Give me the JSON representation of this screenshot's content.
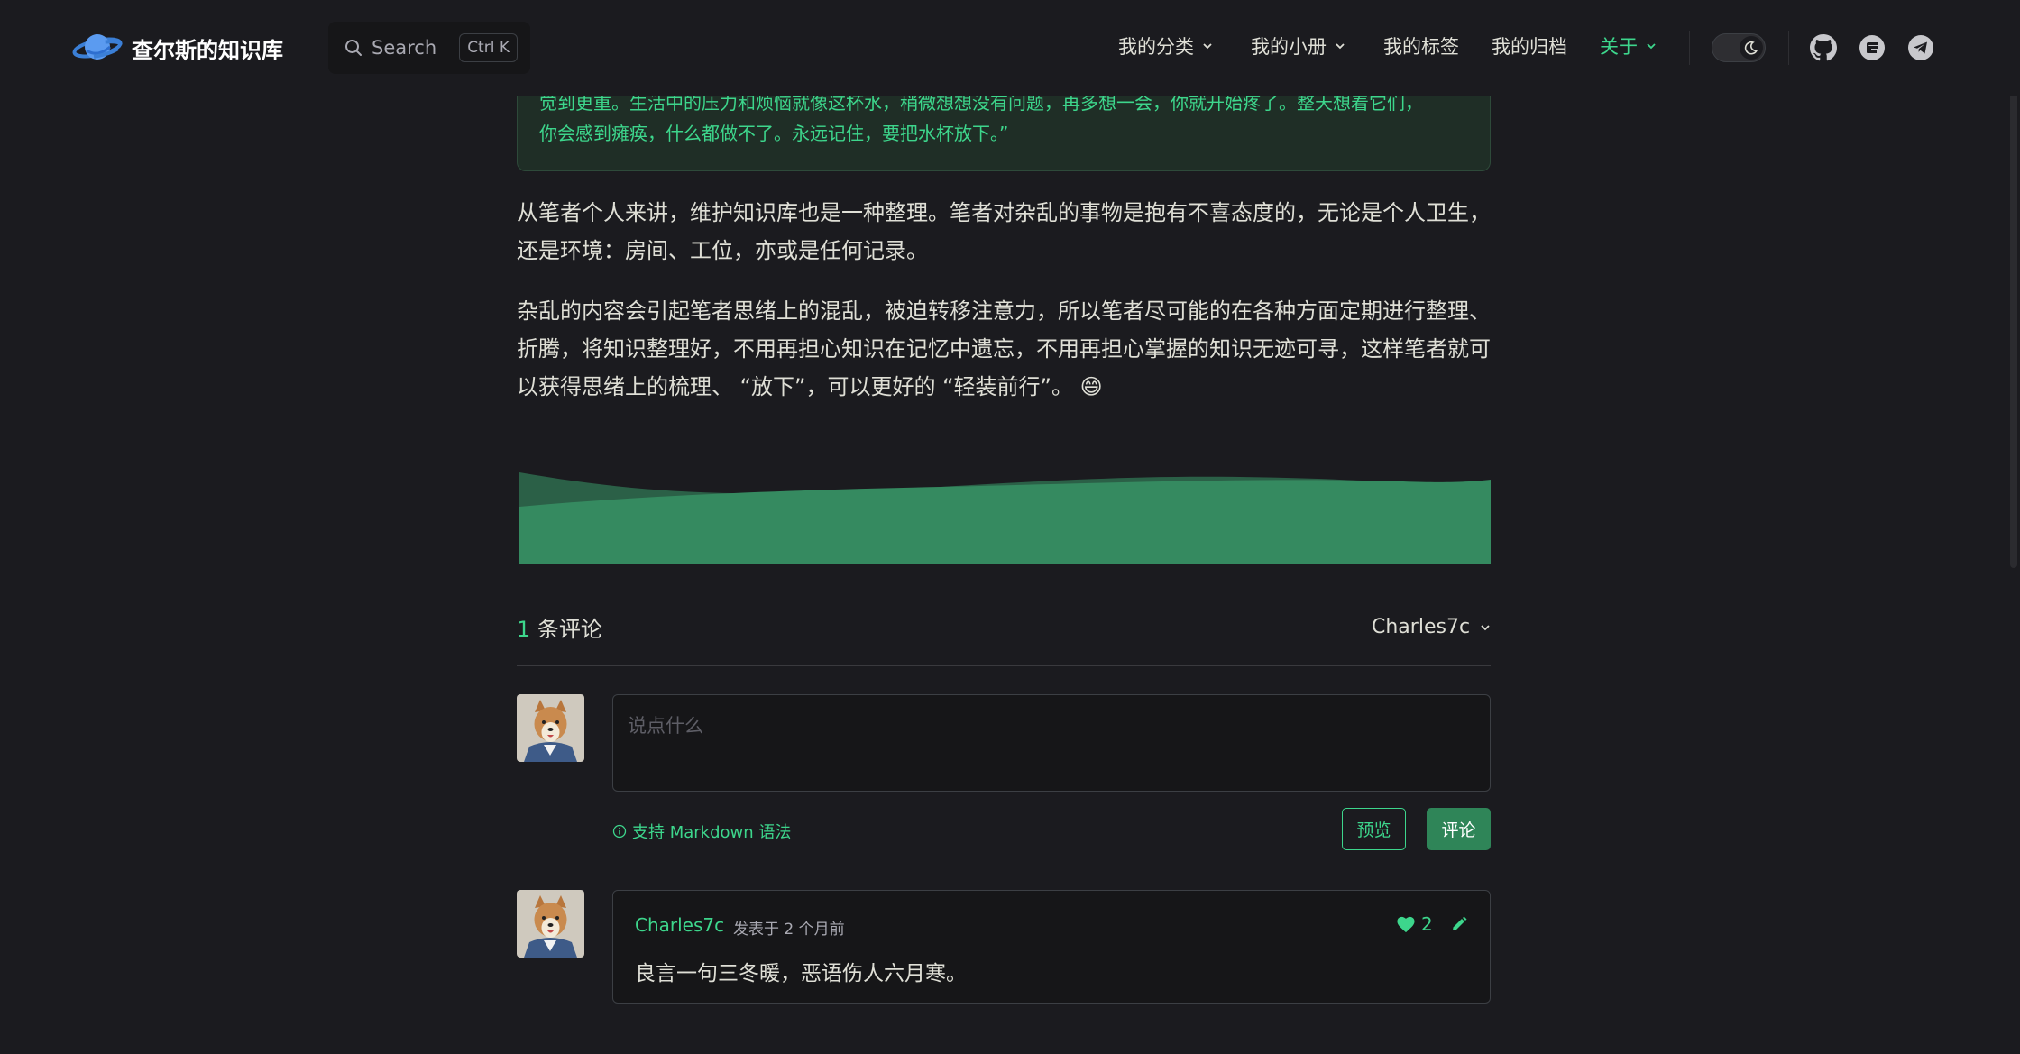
{
  "header": {
    "site_title": "查尔斯的知识库",
    "search": {
      "label": "Search",
      "shortcut": "Ctrl K"
    },
    "nav": [
      {
        "label": "我的分类",
        "dropdown": true
      },
      {
        "label": "我的小册",
        "dropdown": true
      },
      {
        "label": "我的标签",
        "dropdown": false
      },
      {
        "label": "我的归档",
        "dropdown": false
      },
      {
        "label": "关于",
        "dropdown": true,
        "active": true
      }
    ],
    "theme_toggle": "dark",
    "social": [
      "github-icon",
      "gitee-icon",
      "telegram-icon"
    ]
  },
  "article": {
    "quote_lines": [
      "觉到更重。生活中的压力和烦恼就像这杯水，稍微想想没有问题，再多想一会，你就开始疼了。整天想着它们，",
      "你会感到瘫痪，什么都做不了。永远记住，要把水杯放下。”"
    ],
    "para1": "从笔者个人来讲，维护知识库也是一种整理。笔者对杂乱的事物是抱有不喜态度的，无论是个人卫生，还是环境：房间、工位，亦或是任何记录。",
    "para2": "杂乱的内容会引起笔者思绪上的混乱，被迫转移注意力，所以笔者尽可能的在各种方面定期进行整理、折腾，将知识整理好，不用再担心知识在记忆中遗忘，不用再担心掌握的知识无迹可寻，这样笔者就可以获得思绪上的梳理、 “放下”，可以更好的 “轻装前行”。",
    "emoji": "😄"
  },
  "comments": {
    "count": "1",
    "count_label": "条评论",
    "current_user": "Charles7c",
    "editor_placeholder": "说点什么",
    "markdown_hint": "支持 Markdown 语法",
    "preview_label": "预览",
    "submit_label": "评论",
    "items": [
      {
        "author": "Charles7c",
        "meta": "发表于  2 个月前",
        "likes": "2",
        "text": "良言一句三冬暖，恶语伤人六月寒。"
      }
    ]
  },
  "colors": {
    "accent": "#3dd68c",
    "background": "#1b1b1f",
    "wave": "#358a60"
  }
}
